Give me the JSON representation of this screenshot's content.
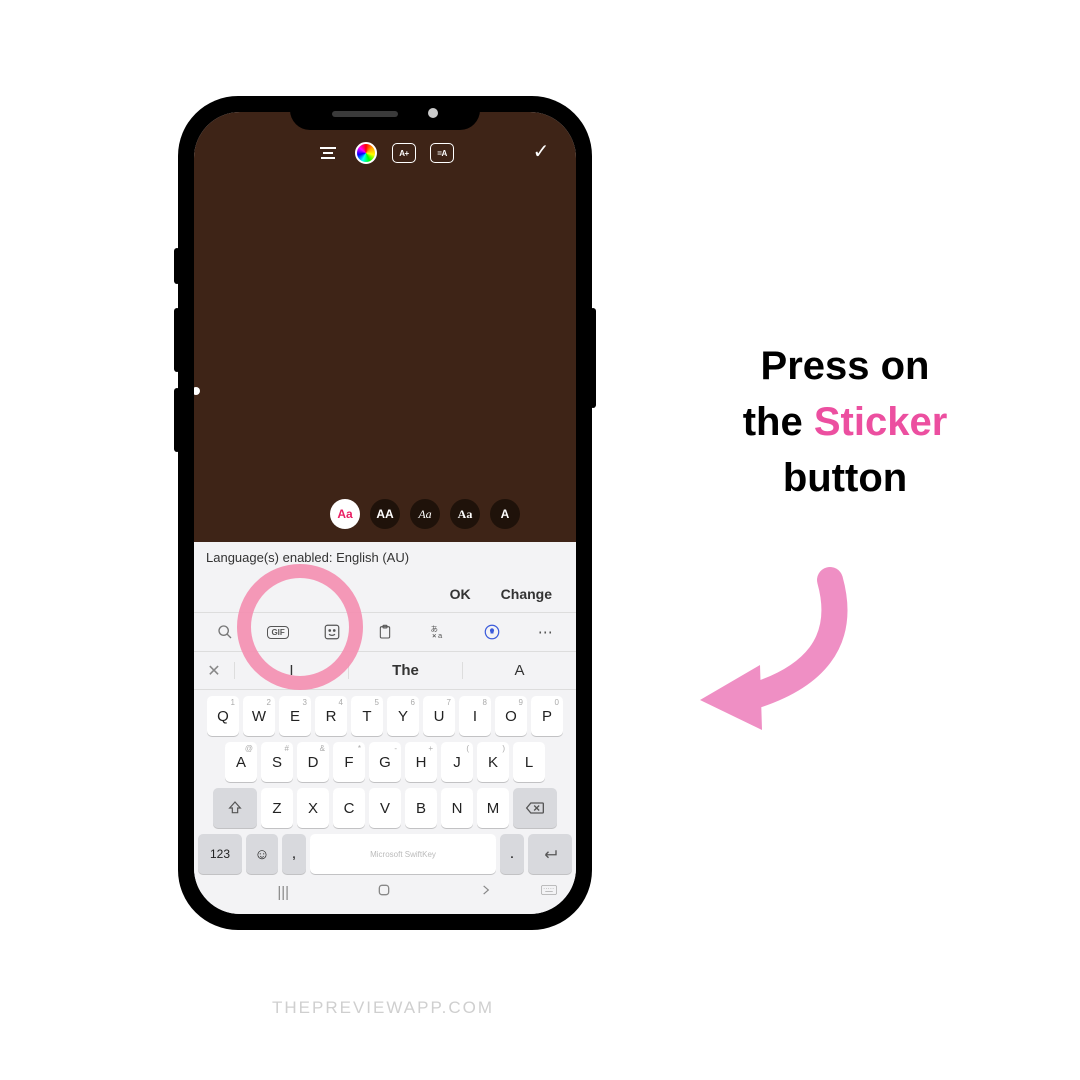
{
  "caption": {
    "line1": "Press on",
    "line2a": "the",
    "line2b": "Sticker",
    "line3": "button"
  },
  "watermark": "THEPREVIEWAPP.COM",
  "story_toolbar": {
    "text_size_label": "A+",
    "text_bg_label": "=A"
  },
  "font_chips": [
    {
      "label": "Aa",
      "class": "active"
    },
    {
      "label": "AA",
      "class": ""
    },
    {
      "label": "Aa",
      "class": "script"
    },
    {
      "label": "Aa",
      "class": "serif"
    },
    {
      "label": "A",
      "class": ""
    }
  ],
  "keyboard": {
    "lang_msg": "Language(s) enabled: English (AU)",
    "ok": "OK",
    "change": "Change",
    "toolbar": {
      "gif": "GIF"
    },
    "suggestions": {
      "s1": "I",
      "s2": "The",
      "s3": "A"
    },
    "row1": [
      {
        "k": "Q",
        "a": "1"
      },
      {
        "k": "W",
        "a": "2"
      },
      {
        "k": "E",
        "a": "3"
      },
      {
        "k": "R",
        "a": "4"
      },
      {
        "k": "T",
        "a": "5"
      },
      {
        "k": "Y",
        "a": "6"
      },
      {
        "k": "U",
        "a": "7"
      },
      {
        "k": "I",
        "a": "8"
      },
      {
        "k": "O",
        "a": "9"
      },
      {
        "k": "P",
        "a": "0"
      }
    ],
    "row2": [
      {
        "k": "A",
        "a": "@"
      },
      {
        "k": "S",
        "a": "#"
      },
      {
        "k": "D",
        "a": "&"
      },
      {
        "k": "F",
        "a": "*"
      },
      {
        "k": "G",
        "a": "-"
      },
      {
        "k": "H",
        "a": "+"
      },
      {
        "k": "J",
        "a": "("
      },
      {
        "k": "K",
        "a": ")"
      },
      {
        "k": "L",
        "a": ""
      }
    ],
    "row3": [
      {
        "k": "Z",
        "a": ""
      },
      {
        "k": "X",
        "a": ""
      },
      {
        "k": "C",
        "a": ""
      },
      {
        "k": "V",
        "a": ""
      },
      {
        "k": "B",
        "a": ""
      },
      {
        "k": "N",
        "a": ""
      },
      {
        "k": "M",
        "a": ""
      }
    ],
    "num_label": "123",
    "space_label": "Microsoft SwiftKey"
  }
}
